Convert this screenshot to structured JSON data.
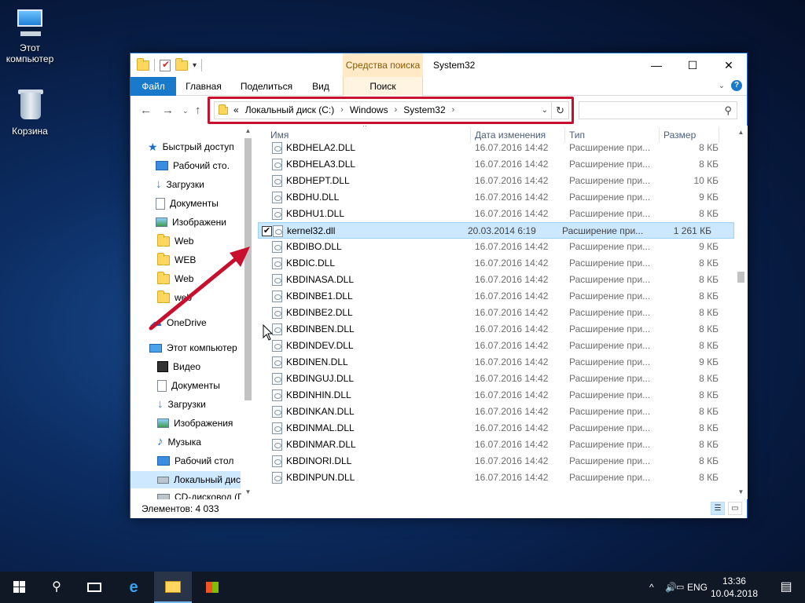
{
  "desktop": {
    "icons": [
      {
        "label": "Этот\nкомпьютер"
      },
      {
        "label": "Корзина"
      }
    ],
    "pc_label_line1": "Этот",
    "pc_label_line2": "компьютер",
    "bin_label": "Корзина"
  },
  "window": {
    "context_tab": "Средства поиска",
    "title": "System32",
    "controls": {
      "minimize": "—",
      "maximize": "☐",
      "close": "✕"
    }
  },
  "ribbon": {
    "tabs": [
      "Файл",
      "Главная",
      "Поделиться",
      "Вид",
      "Поиск"
    ]
  },
  "address": {
    "prefix": "«",
    "crumbs": [
      "Локальный диск (C:)",
      "Windows",
      "System32"
    ],
    "search_placeholder": ""
  },
  "navpane": {
    "items": [
      {
        "label": "Быстрый доступ",
        "icon": "star-icon"
      },
      {
        "label": "Рабочий сто.",
        "icon": "desktop-icon",
        "pinned": true
      },
      {
        "label": "Загрузки",
        "icon": "download-icon",
        "pinned": true
      },
      {
        "label": "Документы",
        "icon": "document-icon",
        "pinned": true
      },
      {
        "label": "Изображени",
        "icon": "pictures-icon",
        "pinned": true
      },
      {
        "label": "Web",
        "icon": "folder-icon"
      },
      {
        "label": "WEB",
        "icon": "folder-icon"
      },
      {
        "label": "Web",
        "icon": "folder-icon"
      },
      {
        "label": "web",
        "icon": "folder-icon"
      },
      {
        "label": "OneDrive",
        "icon": "cloud-icon"
      },
      {
        "label": "Этот компьютер",
        "icon": "computer-icon"
      },
      {
        "label": "Видео",
        "icon": "video-icon"
      },
      {
        "label": "Документы",
        "icon": "document-icon"
      },
      {
        "label": "Загрузки",
        "icon": "download-icon"
      },
      {
        "label": "Изображения",
        "icon": "pictures-icon"
      },
      {
        "label": "Музыка",
        "icon": "music-icon"
      },
      {
        "label": "Рабочий стол",
        "icon": "desktop-icon"
      },
      {
        "label": "Локальный дис",
        "icon": "drive-icon"
      },
      {
        "label": "CD-дисковод (D",
        "icon": "drive-icon"
      }
    ]
  },
  "columns": {
    "name": "Имя",
    "date": "Дата изменения",
    "type": "Тип",
    "size": "Размер"
  },
  "files": [
    {
      "name": "KBDHELA2.DLL",
      "date": "16.07.2016 14:42",
      "type": "Расширение при...",
      "size": "8 КБ"
    },
    {
      "name": "KBDHELA3.DLL",
      "date": "16.07.2016 14:42",
      "type": "Расширение при...",
      "size": "8 КБ"
    },
    {
      "name": "KBDHEPT.DLL",
      "date": "16.07.2016 14:42",
      "type": "Расширение при...",
      "size": "10 КБ"
    },
    {
      "name": "KBDHU.DLL",
      "date": "16.07.2016 14:42",
      "type": "Расширение при...",
      "size": "9 КБ"
    },
    {
      "name": "KBDHU1.DLL",
      "date": "16.07.2016 14:42",
      "type": "Расширение при...",
      "size": "8 КБ"
    },
    {
      "name": "kernel32.dll",
      "date": "20.03.2014 6:19",
      "type": "Расширение при...",
      "size": "1 261 КБ",
      "selected": true
    },
    {
      "name": "KBDIBO.DLL",
      "date": "16.07.2016 14:42",
      "type": "Расширение при...",
      "size": "9 КБ"
    },
    {
      "name": "KBDIC.DLL",
      "date": "16.07.2016 14:42",
      "type": "Расширение при...",
      "size": "8 КБ"
    },
    {
      "name": "KBDINASA.DLL",
      "date": "16.07.2016 14:42",
      "type": "Расширение при...",
      "size": "8 КБ"
    },
    {
      "name": "KBDINBE1.DLL",
      "date": "16.07.2016 14:42",
      "type": "Расширение при...",
      "size": "8 КБ"
    },
    {
      "name": "KBDINBE2.DLL",
      "date": "16.07.2016 14:42",
      "type": "Расширение при...",
      "size": "8 КБ"
    },
    {
      "name": "KBDINBEN.DLL",
      "date": "16.07.2016 14:42",
      "type": "Расширение при...",
      "size": "8 КБ"
    },
    {
      "name": "KBDINDEV.DLL",
      "date": "16.07.2016 14:42",
      "type": "Расширение при...",
      "size": "8 КБ"
    },
    {
      "name": "KBDINEN.DLL",
      "date": "16.07.2016 14:42",
      "type": "Расширение при...",
      "size": "9 КБ"
    },
    {
      "name": "KBDINGUJ.DLL",
      "date": "16.07.2016 14:42",
      "type": "Расширение при...",
      "size": "8 КБ"
    },
    {
      "name": "KBDINHIN.DLL",
      "date": "16.07.2016 14:42",
      "type": "Расширение при...",
      "size": "8 КБ"
    },
    {
      "name": "KBDINKAN.DLL",
      "date": "16.07.2016 14:42",
      "type": "Расширение при...",
      "size": "8 КБ"
    },
    {
      "name": "KBDINMAL.DLL",
      "date": "16.07.2016 14:42",
      "type": "Расширение при...",
      "size": "8 КБ"
    },
    {
      "name": "KBDINMAR.DLL",
      "date": "16.07.2016 14:42",
      "type": "Расширение при...",
      "size": "8 КБ"
    },
    {
      "name": "KBDINORI.DLL",
      "date": "16.07.2016 14:42",
      "type": "Расширение при...",
      "size": "8 КБ"
    },
    {
      "name": "KBDINPUN.DLL",
      "date": "16.07.2016 14:42",
      "type": "Расширение при...",
      "size": "8 КБ"
    }
  ],
  "status": {
    "items_count": "Элементов: 4 033"
  },
  "taskbar": {
    "lang": "ENG",
    "time": "13:36",
    "date": "10.04.2018"
  },
  "colors": {
    "accent": "#1979ca",
    "highlight_frame": "#c8102e",
    "selection": "#cce8ff"
  }
}
